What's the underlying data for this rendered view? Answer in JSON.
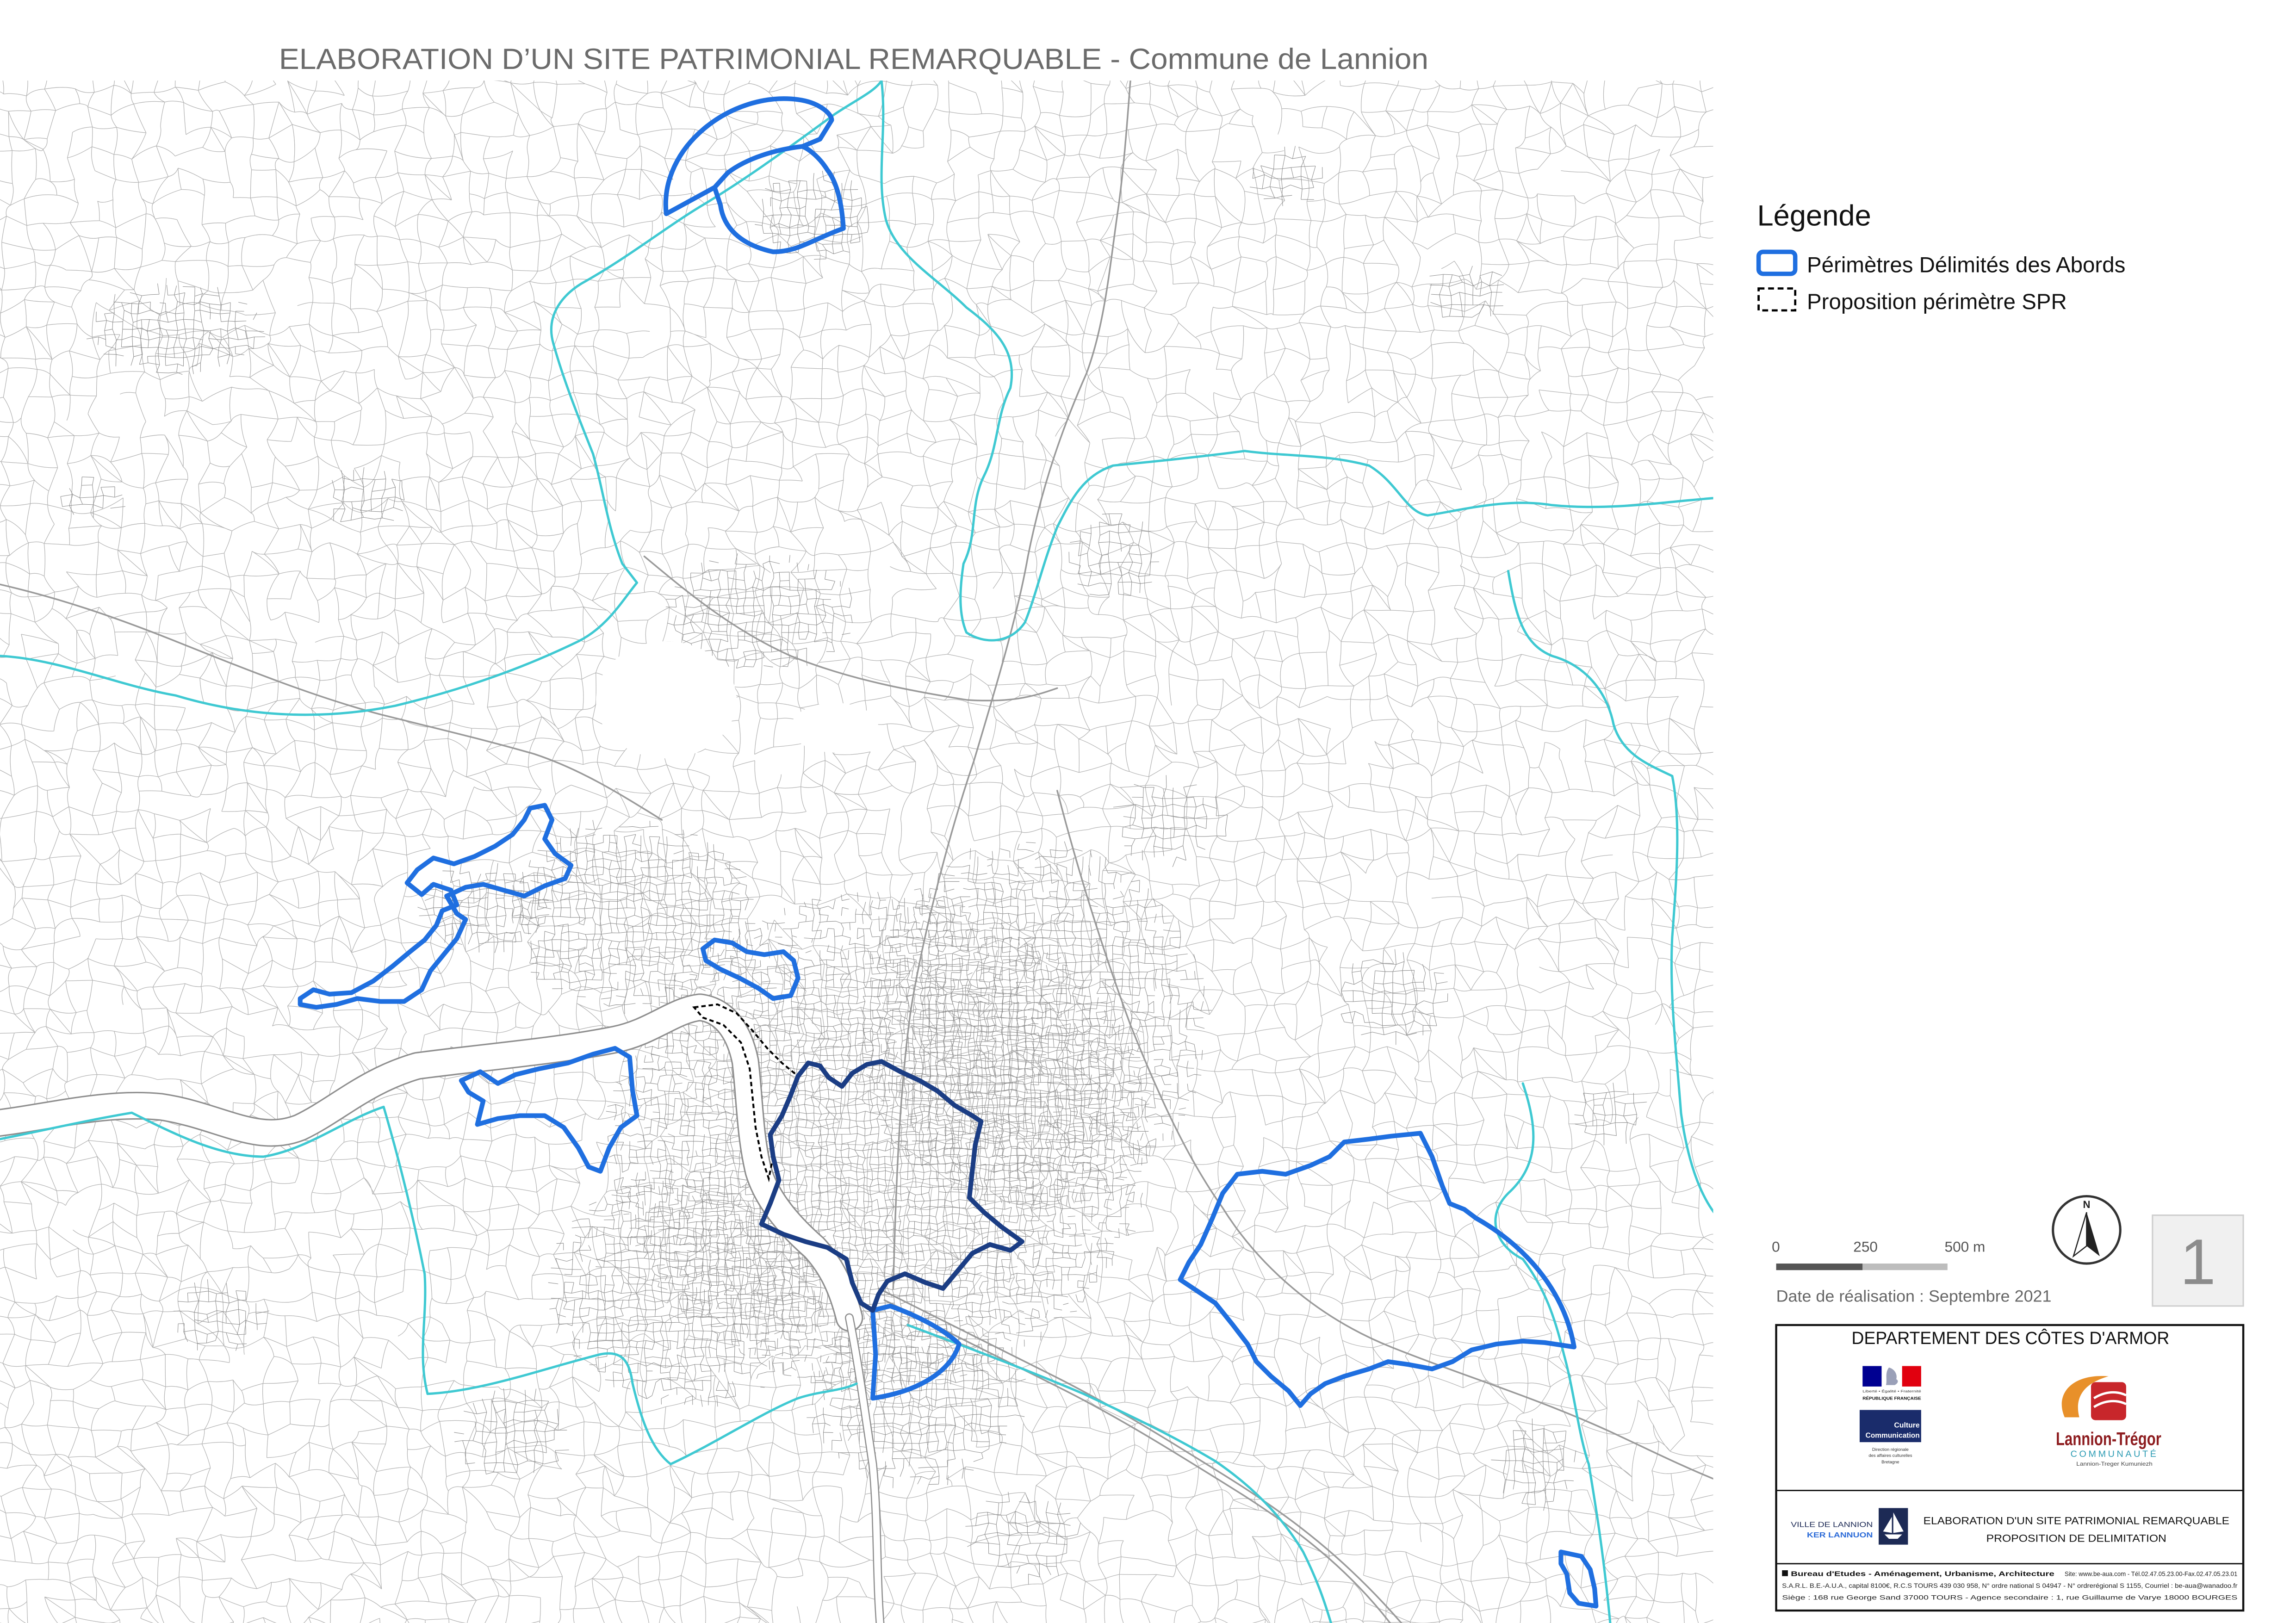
{
  "title": "ELABORATION D’UN SITE PATRIMONIAL REMARQUABLE - Commune de Lannion",
  "legend": {
    "heading": "Légende",
    "items": [
      {
        "label": "Périmètres Délimités des Abords",
        "color": "#1f6fe0"
      },
      {
        "label": "Proposition périmètre SPR",
        "color": "#000000"
      }
    ]
  },
  "map": {
    "colors": {
      "abords_perimeter": "#1f6fe0",
      "central_perimeter": "#1b3d84",
      "spr_perimeter": "#000000",
      "commune_boundary": "#3fc9d2",
      "parcels": "#b0b0b0"
    }
  },
  "scale_bar": {
    "labels": [
      "0",
      "250",
      "500 m"
    ]
  },
  "date": "Date de réalisation : Septembre 2021",
  "north_arrow": {
    "label": "N",
    "icon": "north-arrow-icon"
  },
  "sheet_number": "1",
  "cartouche": {
    "department": "DEPARTEMENT DES CÔTES D'ARMOR",
    "logos": {
      "republique": {
        "motto": "Liberté • Égalité • Fraternité",
        "name": "RÉPUBLIQUE FRANÇAISE",
        "icon": "marianne-logo-icon"
      },
      "culture": {
        "line1": "Culture",
        "line2": "Communication",
        "caption": [
          "Direction régionale",
          "des affaires culturelles",
          "Bretagne"
        ],
        "icon": "culture-logo-icon"
      },
      "lannion_tregor": {
        "name": "Lannion-Trégor",
        "sub": "COMMUNAUTÉ",
        "breton": "Lannion-Treger Kumuniezh",
        "icon": "lannion-tregor-logo-icon"
      },
      "ville": {
        "name": "VILLE DE LANNION",
        "breton": "KER LANNUON",
        "icon": "ville-lannion-emblem-icon"
      }
    },
    "project_title": "ELABORATION D'UN SITE PATRIMONIAL REMARQUABLE",
    "project_subtitle": "PROPOSITION DE DELIMITATION",
    "office": {
      "name": "Bureau d'Etudes - Aménagement, Urbanisme, Architecture",
      "contact": "Site: www.be-aua.com - Tél.02.47.05.23.00-Fax.02.47.05.23.01",
      "legal": "S.A.R.L. B.E.-A.U.A., capital 8100€, R.C.S TOURS 439 030 958, N° ordre national S 04947 - N° ordrerégional S 1155, Courriel : be-aua@wanadoo.fr",
      "address": "Siège : 168 rue George Sand 37000 TOURS - Agence secondaire : 1, rue Guillaume de Varye 18000 BOURGES"
    }
  }
}
